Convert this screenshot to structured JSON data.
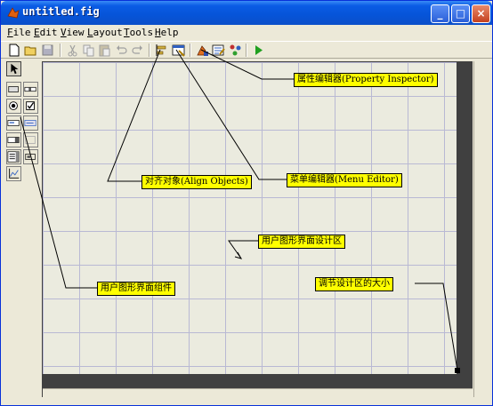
{
  "window": {
    "title": "untitled.fig",
    "controls": {
      "minimize": "_",
      "maximize": "□",
      "close": "×"
    }
  },
  "menu": [
    {
      "first": "F",
      "rest": "ile"
    },
    {
      "first": "E",
      "rest": "dit"
    },
    {
      "first": "V",
      "rest": "iew"
    },
    {
      "first": "L",
      "rest": "ayout"
    },
    {
      "first": "T",
      "rest": "ools"
    },
    {
      "first": "H",
      "rest": "elp"
    }
  ],
  "toolbar": {
    "icons": [
      "new-icon",
      "open-icon",
      "save-icon",
      "cut-icon",
      "copy-icon",
      "paste-icon",
      "undo-icon",
      "redo-icon",
      "align-objects-icon",
      "menu-editor-icon",
      "property-inspector-icon",
      "object-browser-icon",
      "run-icon"
    ]
  },
  "palette": {
    "icons": [
      "select-arrow-icon",
      "push-button-icon",
      "slider-icon",
      "radio-button-icon",
      "checkbox-icon",
      "edit-text-icon",
      "static-text-icon",
      "popup-menu-icon",
      "listbox-icon",
      "toggle-button-icon",
      "frame-icon",
      "axes-icon"
    ]
  },
  "callouts": {
    "property_inspector": "属性编辑器(Property Inspector)",
    "align_objects": "对齐对象(Align Objects)",
    "menu_editor": "菜单编辑器(Menu Editor)",
    "design_area": "用户图形界面设计区",
    "gui_components": "用户图形界面组件",
    "resize_area": "调节设计区的大小"
  },
  "colors": {
    "callout_bg": "#ffff00",
    "titlebar": "#0654d8",
    "grid_bg": "#ebebdf",
    "grid_line": "#b9b9d4"
  }
}
